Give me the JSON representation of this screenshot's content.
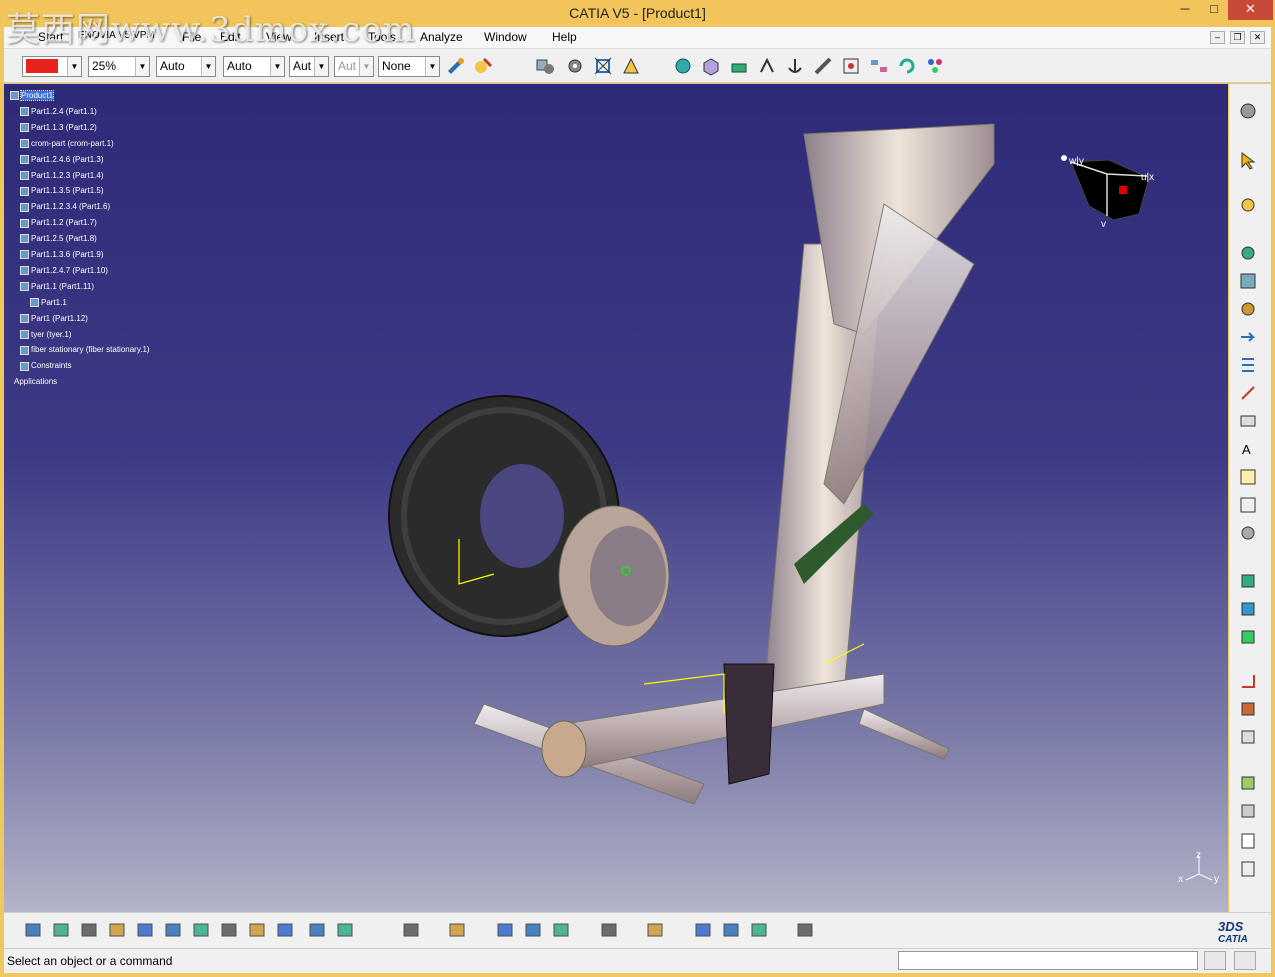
{
  "watermark": "莫西网www.3dmox.com",
  "window": {
    "title": "CATIA V5 - [Product1]",
    "min": "─",
    "max": "□",
    "close": "✕"
  },
  "menu": [
    "Start",
    "ENOVIA V5 VPM",
    "File",
    "Edit",
    "View",
    "Insert",
    "Tools",
    "Analyze",
    "Window",
    "Help"
  ],
  "mdi": {
    "min": "–",
    "restore": "❐",
    "close": "✕"
  },
  "toolbar": {
    "color": "#e8221c",
    "transparency": "25%",
    "thickness": "Auto",
    "linetype": "Auto",
    "layer1": "Aut",
    "layer2": "Aut",
    "render": "None"
  },
  "tree": [
    {
      "label": "Product1",
      "level": 0,
      "selected": true
    },
    {
      "label": "Part1.2.4 (Part1.1)",
      "level": 1
    },
    {
      "label": "Part1.1.3 (Part1.2)",
      "level": 1
    },
    {
      "label": "crom-part (crom-part.1)",
      "level": 1
    },
    {
      "label": "Part1.2.4.6 (Part1.3)",
      "level": 1
    },
    {
      "label": "Part1.1.2.3 (Part1.4)",
      "level": 1
    },
    {
      "label": "Part1.1.3.5 (Part1.5)",
      "level": 1
    },
    {
      "label": "Part1.1.2.3.4 (Part1.6)",
      "level": 1
    },
    {
      "label": "Part1.1.2 (Part1.7)",
      "level": 1
    },
    {
      "label": "Part1.2.5 (Part1.8)",
      "level": 1
    },
    {
      "label": "Part1.1.3.6 (Part1.9)",
      "level": 1
    },
    {
      "label": "Part1.2.4.7 (Part1.10)",
      "level": 1
    },
    {
      "label": "Part1.1 (Part1.11)",
      "level": 1
    },
    {
      "label": "Part1.1",
      "level": 2
    },
    {
      "label": "Part1 (Part1.12)",
      "level": 1
    },
    {
      "label": "tyer (tyer.1)",
      "level": 1
    },
    {
      "label": "fiber stationary (fiber stationary.1)",
      "level": 1
    },
    {
      "label": "Constraints",
      "level": 1
    },
    {
      "label": "Applications",
      "level": 0
    }
  ],
  "compass": {
    "u": "u|x",
    "v": "v",
    "w": "w|y"
  },
  "axis": {
    "x": "x",
    "y": "y",
    "z": "z"
  },
  "status": "Select an object or a command",
  "brand": "CATIA",
  "model": {
    "tire_color": "#2b2b2b",
    "metal_color": "#c9b7a9",
    "highlight_color": "#ffff00"
  }
}
